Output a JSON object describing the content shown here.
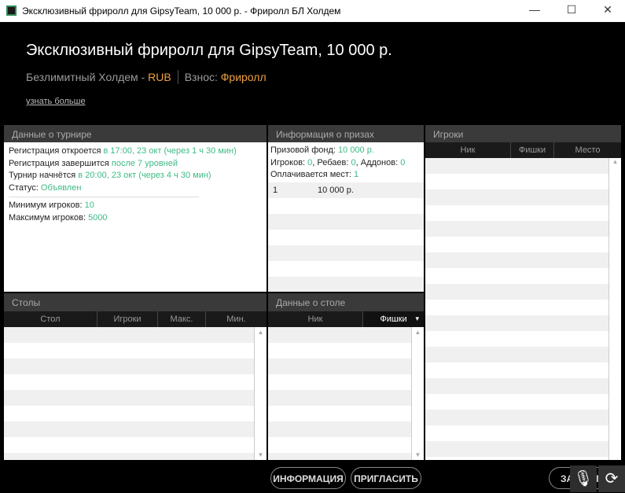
{
  "window": {
    "title": "Эксклюзивный фриролл для GipsyTeam, 10 000 р. - Фриролл БЛ Холдем",
    "minimize": "—",
    "maximize": "☐",
    "close": "✕"
  },
  "header": {
    "title": "Эксклюзивный фриролл для GipsyTeam, 10 000 р.",
    "game": "Безлимитный Холдем - ",
    "currency": "RUB",
    "fee_label": "Взнос: ",
    "fee": "Фриролл",
    "learn_more": "узнать больше"
  },
  "tournament": {
    "title": "Данные о турнире",
    "reg_open_label": "Регистрация откроется ",
    "reg_open": "в 17:00, 23 окт (через 1 ч 30 мин)",
    "reg_close_label": "Регистрация завершится ",
    "reg_close": "после 7 уровней",
    "start_label": "Турнир начнётся ",
    "start": "в 20:00, 23 окт (через 4 ч 30 мин)",
    "status_label": "Статус: ",
    "status": "Объявлен",
    "min_label": "Минимум игроков: ",
    "min": "10",
    "max_label": "Максимум игроков: ",
    "max": "5000"
  },
  "prizes": {
    "title": "Информация о призах",
    "fund_label": "Призовой фонд: ",
    "fund": "10 000 р.",
    "players_label": "Игроков: ",
    "players": "0",
    "rebuys_label": ", Ребаев: ",
    "rebuys": "0",
    "addons_label": ", Аддонов: ",
    "addons": "0",
    "paid_label": "Оплачивается мест: ",
    "paid": "1",
    "rows": [
      {
        "place": "1",
        "amount": "10 000 р."
      }
    ]
  },
  "players": {
    "title": "Игроки",
    "cols": [
      "Ник",
      "Фишки",
      "Место"
    ]
  },
  "tables": {
    "title": "Столы",
    "cols": [
      "Стол",
      "Игроки",
      "Макс.",
      "Мин."
    ]
  },
  "table_data": {
    "title": "Данные о столе",
    "cols": [
      "Ник",
      "Фишки"
    ],
    "sort_icon": "▾"
  },
  "buttons": {
    "info": "ИНФОРМАЦИЯ",
    "invite": "ПРИГЛАСИТЬ",
    "close": "ЗАКРЫТЬ"
  },
  "colors": {
    "accent_green": "#3dbb85",
    "accent_orange": "#f0a040"
  }
}
